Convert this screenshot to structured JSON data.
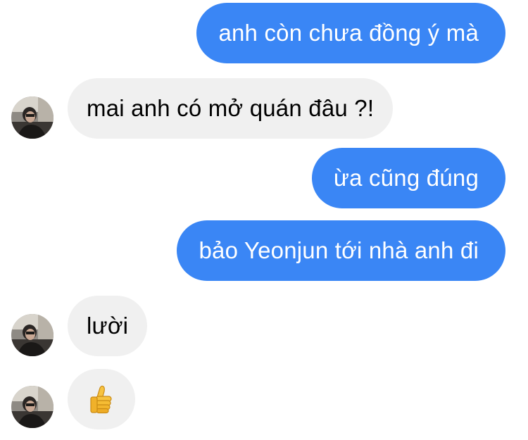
{
  "conversation": {
    "messages": [
      {
        "sender": "me",
        "text": "anh còn chưa đồng ý mà"
      },
      {
        "sender": "other",
        "text": "mai anh có mở quán đâu ?!"
      },
      {
        "sender": "me",
        "text": "ừa cũng đúng"
      },
      {
        "sender": "me",
        "text": "bảo Yeonjun tới nhà anh đi"
      },
      {
        "sender": "other",
        "text": "lười"
      },
      {
        "sender": "other",
        "emoji": "thumbs-up-icon"
      }
    ]
  },
  "colors": {
    "sent_bubble": "#3a86f5",
    "received_bubble": "#f0f0f0",
    "sent_text": "#ffffff",
    "received_text": "#000000"
  }
}
